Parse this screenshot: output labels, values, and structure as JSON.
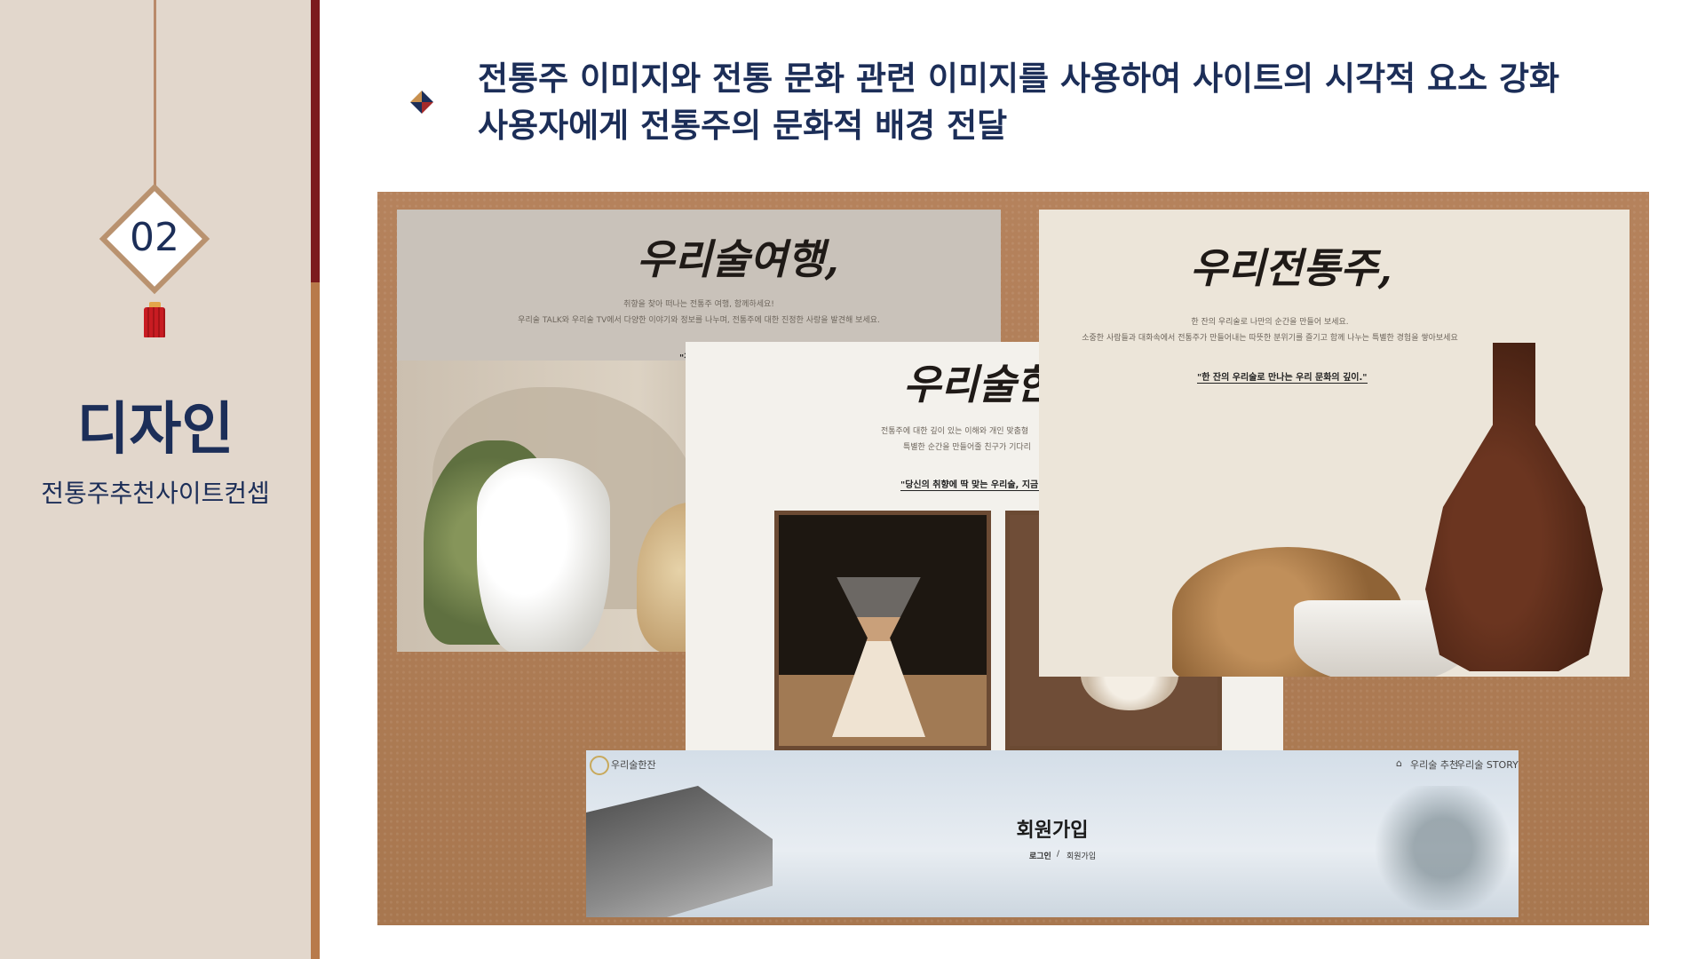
{
  "sidebar": {
    "section_number": "02",
    "title": "디자인",
    "subtitle": "전통주추천사이트컨셉"
  },
  "headline": {
    "line1": "전통주 이미지와 전통 문화 관련 이미지를 사용하여 사이트의 시각적 요소 강화",
    "line2": "사용자에게 전통주의 문화적 배경 전달"
  },
  "collage": {
    "travel": {
      "title": "우리술여행,",
      "desc1": "취향을 찾아 떠나는 전통주 여행, 함께하세요!",
      "desc2": "우리술 TALK와 우리술 TV에서 다양한 이야기와 정보를 나누며, 전통주에 대한 진정한 사랑을 발견해 보세요.",
      "quote": "\"전"
    },
    "hanjan": {
      "title": "우리술한잔",
      "desc1": "전통주에 대한 깊이 있는 이해와 개인 맞춤형",
      "desc2": "특별한 순간을 만들어줄 친구가 기다리",
      "quote": "\"당신의 취향에 딱 맞는 우리술, 지금 발"
    },
    "traditional": {
      "title": "우리전통주,",
      "desc1": "한 잔의 우리술로 나만의 순간을 만들어 보세요.",
      "desc2": "소중한 사람들과 대화속에서 전통주가 만들어내는 따뜻한 분위기를 즐기고 함께 나누는 특별한 경험을 쌓아보세요",
      "quote": "\"한 잔의 우리술로 만나는 우리 문화의 깊이.\""
    },
    "signup": {
      "brand": "우리술한잔",
      "nav1": "우리술 추천",
      "nav2": "우리술 STORY",
      "title": "회원가입",
      "crumb_login": "로그인",
      "crumb_sep": "/",
      "crumb_current": "회원가입"
    }
  },
  "colors": {
    "navy": "#1c2e58",
    "sidebar_bg": "#e2d7cc",
    "accent_red": "#7c1b1e",
    "accent_copper": "#b87a4a"
  }
}
